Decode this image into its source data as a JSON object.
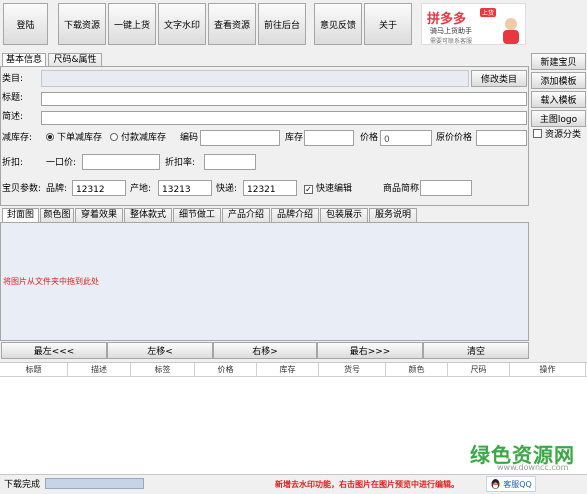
{
  "toolbar": {
    "login": "登陆",
    "download": "下载资源",
    "one_click_upload": "一键上货",
    "watermark": "文字水印",
    "view_resources": "查看资源",
    "goto_backend": "前往后台",
    "feedback": "意见反馈",
    "about": "关于"
  },
  "ad": {
    "logo": "拼多多",
    "badge": "上货",
    "line1": "骑马上货助手",
    "line2": "需要可联系客服"
  },
  "tabs_top": [
    "基本信息",
    "尺码&属性"
  ],
  "sidebar": {
    "new_item": "新建宝贝",
    "add_template": "添加模板",
    "load_template": "载入模板",
    "main_logo": "主图logo",
    "resource_category": "资源分类"
  },
  "form": {
    "category_label": "类目:",
    "modify_category": "修改类目",
    "title_label": "标题:",
    "desc_label": "简述:",
    "stock_label": "减库存:",
    "stock_opt1": "下单减库存",
    "stock_opt2": "付款减库存",
    "code_label": "编码",
    "inventory_label": "库存",
    "price_label": "价格",
    "price_value": "0",
    "orig_price_label": "原价价格",
    "discount_label": "折扣:",
    "fixed_price_label": "一口价:",
    "discount_rate_label": "折扣率:",
    "params_label": "宝贝参数:",
    "brand_label": "品牌:",
    "brand_value": "12312",
    "origin_label": "产地:",
    "origin_value": "13213",
    "express_label": "快递:",
    "express_value": "12321",
    "quick_edit": "快速编辑",
    "product_name_label": "商品简称"
  },
  "image_tabs": [
    "封面图",
    "颜色图",
    "穿着效果",
    "整体款式",
    "细节做工",
    "产品介绍",
    "品牌介绍",
    "包装展示",
    "服务说明"
  ],
  "drop_hint": "将图片从文件夹中拖到此处",
  "move_buttons": {
    "far_left": "最左<<<",
    "left": "左移<",
    "right": "右移>",
    "far_right": "最右>>>",
    "clear": "清空"
  },
  "table_headers": [
    "标题",
    "描述",
    "标签",
    "价格",
    "库存",
    "货号",
    "颜色",
    "尺码",
    "操作"
  ],
  "status": {
    "text": "下载完成",
    "notice": "新增去水印功能，右击图片在图片预览中进行编辑。",
    "watermark_main": "绿色资源网",
    "watermark_url": "www.downcc.com",
    "qq": "客服QQ"
  },
  "colors": {
    "accent_red": "#e02020",
    "watermark_green": "#3aa845",
    "ad_red": "#e8373f"
  }
}
